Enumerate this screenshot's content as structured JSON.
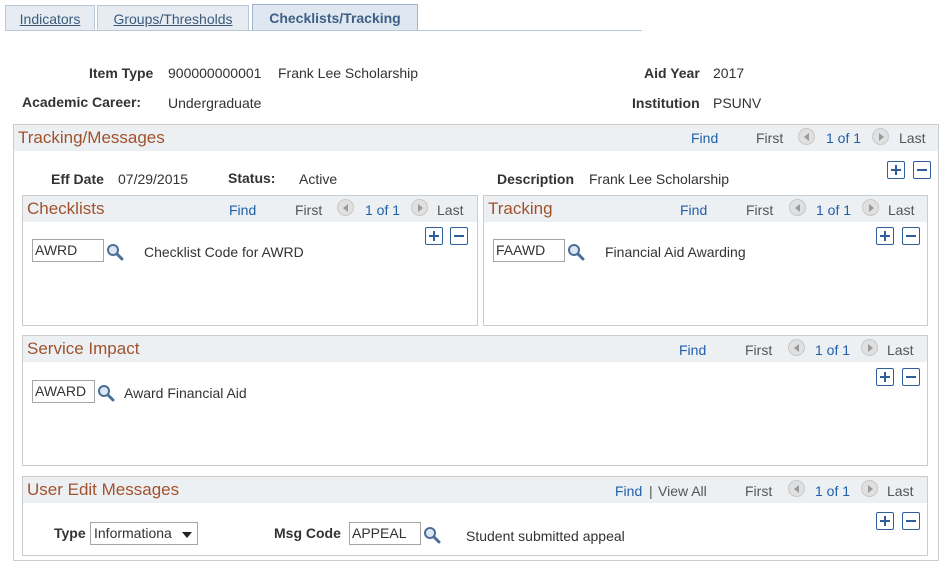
{
  "tabs": [
    {
      "label": "Indicators"
    },
    {
      "label": "Groups/Thresholds"
    },
    {
      "label": "Checklists/Tracking"
    }
  ],
  "header": {
    "item_type_label": "Item Type",
    "item_type_code": "900000000001",
    "item_type_desc": "Frank Lee Scholarship",
    "aid_year_label": "Aid Year",
    "aid_year_value": "2017",
    "academic_career_label": "Academic Career:",
    "academic_career_value": "Undergraduate",
    "institution_label": "Institution",
    "institution_value": "PSUNV"
  },
  "tracking_messages": {
    "title": "Tracking/Messages",
    "find": "Find",
    "first": "First",
    "counter": "1 of 1",
    "last": "Last",
    "eff_date_label": "Eff Date",
    "eff_date_value": "07/29/2015",
    "status_label": "Status:",
    "status_value": "Active",
    "description_label": "Description",
    "description_value": "Frank Lee Scholarship"
  },
  "checklists": {
    "title": "Checklists",
    "find": "Find",
    "first": "First",
    "counter": "1 of 1",
    "last": "Last",
    "code": "AWRD",
    "code_desc": "Checklist Code for AWRD"
  },
  "tracking": {
    "title": "Tracking",
    "find": "Find",
    "first": "First",
    "counter": "1 of 1",
    "last": "Last",
    "code": "FAAWD",
    "code_desc": "Financial Aid Awarding"
  },
  "service_impact": {
    "title": "Service Impact",
    "find": "Find",
    "first": "First",
    "counter": "1 of 1",
    "last": "Last",
    "code": "AWARD",
    "code_desc": "Award Financial Aid"
  },
  "user_edit_messages": {
    "title": "User Edit Messages",
    "find": "Find",
    "separator": "|",
    "view_all": "View All",
    "first": "First",
    "counter": "1 of 1",
    "last": "Last",
    "type_label": "Type",
    "type_value": "Informationa",
    "msg_code_label": "Msg Code",
    "msg_code_value": "APPEAL",
    "msg_code_desc": "Student submitted appeal"
  },
  "colors": {
    "section_title": "#a0522d",
    "link": "#1f5fa8",
    "tab_text": "#3a5a7c"
  }
}
